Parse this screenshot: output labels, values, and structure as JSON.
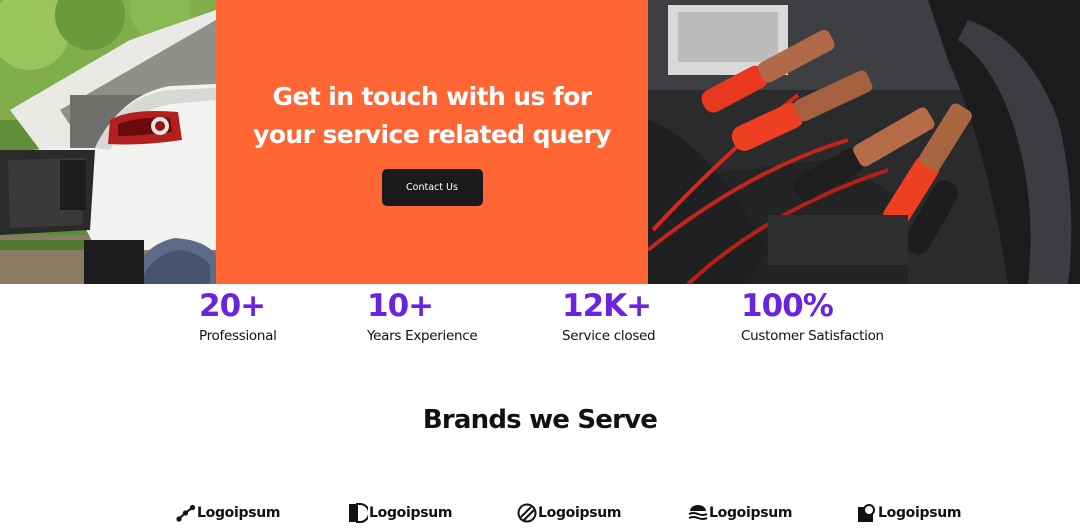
{
  "cta": {
    "title": "Get in touch with us for your service related query",
    "button_label": "Contact Us"
  },
  "stats": [
    {
      "value": "20+",
      "label": "Professional"
    },
    {
      "value": "10+",
      "label": "Years Experience"
    },
    {
      "value": "12K+",
      "label": "Service closed"
    },
    {
      "value": "100%",
      "label": "Customer Satisfaction"
    }
  ],
  "brands": {
    "title": "Brands we Serve",
    "logos": [
      {
        "name": "Logoipsum",
        "icon": "nodes-icon"
      },
      {
        "name": "Logoipsum",
        "icon": "half-block-icon"
      },
      {
        "name": "Logoipsum",
        "icon": "striped-circle-icon"
      },
      {
        "name": "Logoipsum",
        "icon": "waves-icon"
      },
      {
        "name": "Logoipsum",
        "icon": "square-circle-icon"
      }
    ]
  },
  "colors": {
    "accent": "#ff6633",
    "stat_purple": "#6a24e0",
    "button_dark": "#1a1a1a"
  }
}
